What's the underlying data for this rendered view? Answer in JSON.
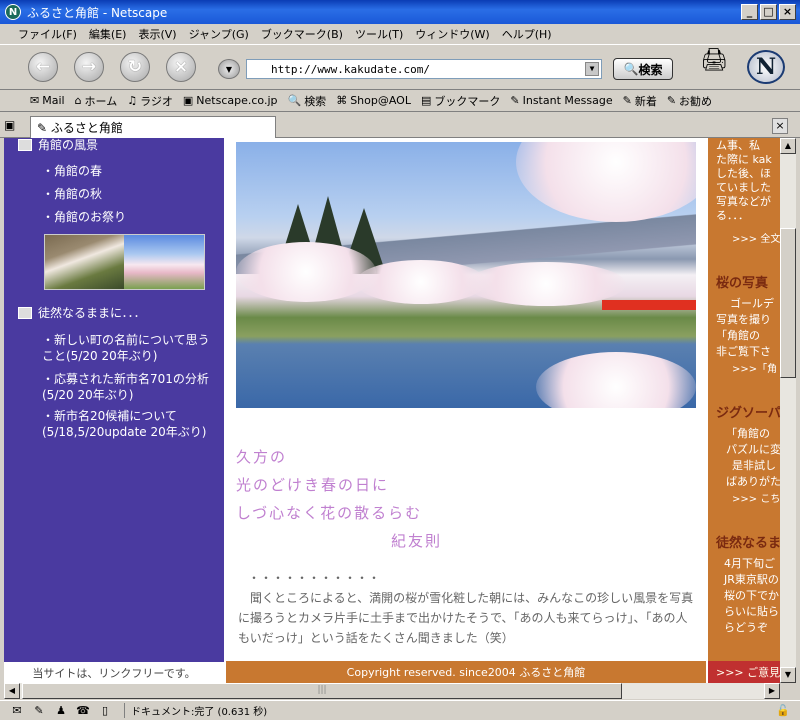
{
  "window": {
    "title": "ふるさと角館 - Netscape"
  },
  "menu": [
    "ファイル(F)",
    "編集(E)",
    "表示(V)",
    "ジャンプ(G)",
    "ブックマーク(B)",
    "ツール(T)",
    "ウィンドウ(W)",
    "ヘルプ(H)"
  ],
  "nav": {
    "url": "http://www.kakudate.com/",
    "search_label": "検索"
  },
  "bookmarks": [
    {
      "label": "Mail",
      "icon": "mail-icon"
    },
    {
      "label": "ホーム",
      "icon": "home-icon"
    },
    {
      "label": "ラジオ",
      "icon": "radio-icon"
    },
    {
      "label": "Netscape.co.jp",
      "icon": "netscape-icon"
    },
    {
      "label": "検索",
      "icon": "search-icon"
    },
    {
      "label": "Shop@AOL",
      "icon": "shop-icon"
    },
    {
      "label": "ブックマーク",
      "icon": "bookmark-icon"
    },
    {
      "label": "Instant Message",
      "icon": "im-icon"
    },
    {
      "label": "新着",
      "icon": "new-icon"
    },
    {
      "label": "お勧め",
      "icon": "recommend-icon"
    }
  ],
  "tab": {
    "label": "ふるさと角館"
  },
  "left": {
    "section1": "角館の風景",
    "items1": [
      "・角館の春",
      "・角館の秋",
      "・角館のお祭り"
    ],
    "section2": "徒然なるままに．．．",
    "items2": [
      "・新しい町の名前について思うこと(5/20 20年ぶり)",
      "・応募された新市名701の分析(5/20 20年ぶり)",
      "・新市名20候補について(5/18,5/20update 20年ぶり)"
    ],
    "footer": "当サイトは、リンクフリーです。"
  },
  "center": {
    "poem": [
      "久方の",
      "光のどけき春の日に",
      "しづ心なく花の散るらむ",
      "紀友則"
    ],
    "dots": "・・・・・・・・・・・",
    "prose": "聞くところによると、満開の桜が雪化粧した朝には、みんなこの珍しい風景を写真に撮ろうとカメラ片手に土手まで出かけたそうで、「あの人も来てらっけ」、「あの人もいだっけ」という話をたくさん聞きました（笑）",
    "footer": "Copyright reserved. since2004 ふるさと角館"
  },
  "right": {
    "text1": [
      "ム事、私",
      "た際に kak",
      "した後、ほ",
      "ていました",
      "写真などが",
      "る．．．"
    ],
    "more1": ">>> 全文",
    "head2": "桜の写真",
    "text2": [
      "ゴールデ",
      "写真を撮り",
      "「角館の",
      "非ご覧下さ"
    ],
    "more2": ">>>「角",
    "head3": "ジグソーパ",
    "text3": [
      "「角館の",
      "パズルに変",
      "是非試し",
      "ばありがた"
    ],
    "more3": ">>> こち",
    "head4": "徒然なるま",
    "text4": [
      "4月下旬ご",
      "JR東京駅の",
      "桜の下でか",
      "らいに貼ら",
      "らどうぞ"
    ],
    "footer": ">>> ご意見・"
  },
  "status": {
    "text": "ドキュメント:完了 (0.631 秒)"
  },
  "colors": {
    "left_bg": "#4a3aa0",
    "right_bg": "#c87830",
    "poem": "#c080d0"
  }
}
